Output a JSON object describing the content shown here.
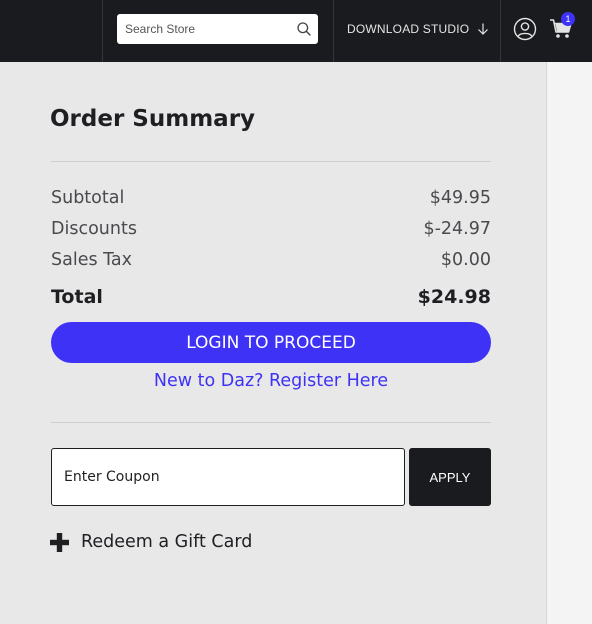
{
  "header": {
    "search_placeholder": "Search Store",
    "download_studio_label": "DOWNLOAD STUDIO",
    "cart_count": "1"
  },
  "summary": {
    "title": "Order Summary",
    "rows": [
      {
        "label": "Subtotal",
        "value": "$49.95"
      },
      {
        "label": "Discounts",
        "value": "$-24.97"
      },
      {
        "label": "Sales Tax",
        "value": "$0.00"
      }
    ],
    "total_label": "Total",
    "total_value": "$24.98",
    "login_label": "LOGIN TO PROCEED",
    "register_label": "New to Daz? Register Here",
    "coupon_placeholder": "Enter Coupon",
    "apply_label": "APPLY",
    "gift_label": "Redeem a Gift Card"
  },
  "colors": {
    "accent": "#3d32f5",
    "topbar": "#1a1b1f",
    "background": "#e8e8e8"
  }
}
